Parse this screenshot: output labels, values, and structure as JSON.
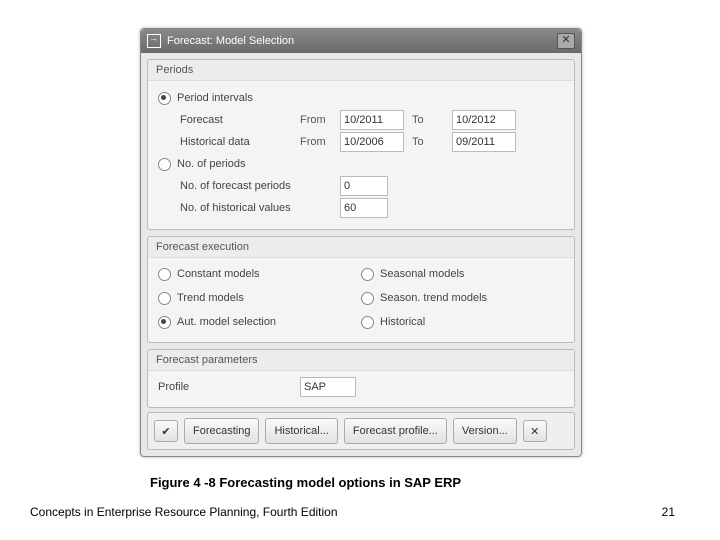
{
  "window": {
    "title": "Forecast: Model Selection"
  },
  "periods": {
    "heading": "Periods",
    "intervals_label": "Period intervals",
    "forecast_label": "Forecast",
    "historical_label": "Historical data",
    "from_label": "From",
    "to_label": "To",
    "forecast_from": "10/2011",
    "forecast_to": "10/2012",
    "hist_from": "10/2006",
    "hist_to": "09/2011",
    "noperiods_label": "No. of periods",
    "num_forecast_label": "No. of forecast periods",
    "num_forecast_value": "0",
    "num_hist_label": "No. of historical values",
    "num_hist_value": "60"
  },
  "exec": {
    "heading": "Forecast execution",
    "constant": "Constant models",
    "trend": "Trend models",
    "auto": "Aut. model selection",
    "seasonal": "Seasonal models",
    "seasontrend": "Season. trend models",
    "historical": "Historical"
  },
  "params": {
    "heading": "Forecast parameters",
    "profile_label": "Profile",
    "profile_value": "SAP"
  },
  "buttons": {
    "forecasting": "Forecasting",
    "historical": "Historical...",
    "profile": "Forecast profile...",
    "version": "Version..."
  },
  "caption": "Figure 4 -8  Forecasting model options in SAP ERP",
  "footer_left": "Concepts in Enterprise Resource Planning, Fourth Edition",
  "footer_right": "21"
}
